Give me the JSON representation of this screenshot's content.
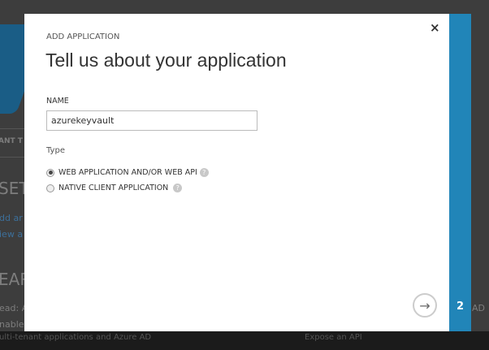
{
  "background": {
    "texts": [
      "ANT T",
      "SET",
      "dd ar",
      "iew a",
      "EAR",
      "ead: A",
      "nable",
      "ulti-tenant applications and Azure AD",
      "Expose an API",
      "AD"
    ]
  },
  "dialog": {
    "subtitle": "ADD APPLICATION",
    "title": "Tell us about your application",
    "close_icon": "×",
    "name_label": "NAME",
    "name_value": "azurekeyvault",
    "type_label": "Type",
    "options": [
      {
        "label": "WEB APPLICATION AND/OR WEB API",
        "selected": true
      },
      {
        "label": "NATIVE CLIENT APPLICATION",
        "selected": false
      }
    ],
    "help_icon": "?",
    "next_icon": "→",
    "step": "2"
  },
  "colors": {
    "accent": "#2185b8"
  }
}
